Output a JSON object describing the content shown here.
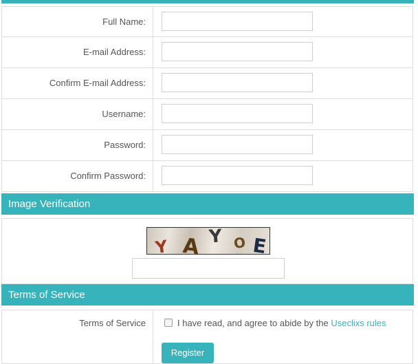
{
  "form": {
    "fields": [
      {
        "label": "Full Name:",
        "value": ""
      },
      {
        "label": "E-mail Address:",
        "value": ""
      },
      {
        "label": "Confirm E-mail Address:",
        "value": ""
      },
      {
        "label": "Username:",
        "value": ""
      },
      {
        "label": "Password:",
        "value": ""
      },
      {
        "label": "Confirm Password:",
        "value": ""
      }
    ]
  },
  "image_verification": {
    "header": "Image Verification",
    "captcha_letters": [
      "Y",
      "A",
      "Y",
      "O",
      "E"
    ],
    "captcha_colors": [
      "#a03a1c",
      "#5a3a12",
      "#3a3a3a",
      "#6b4a1c",
      "#1f2a44"
    ],
    "input_value": ""
  },
  "terms": {
    "header": "Terms of Service",
    "label": "Terms of Service",
    "checkbox_text": "I have read, and agree to abide by the ",
    "link_text": "Useclixs rules",
    "checked": false
  },
  "actions": {
    "register_label": "Register"
  },
  "colors": {
    "accent": "#36b3bb",
    "border": "#dcdcdc",
    "text": "#555555"
  }
}
